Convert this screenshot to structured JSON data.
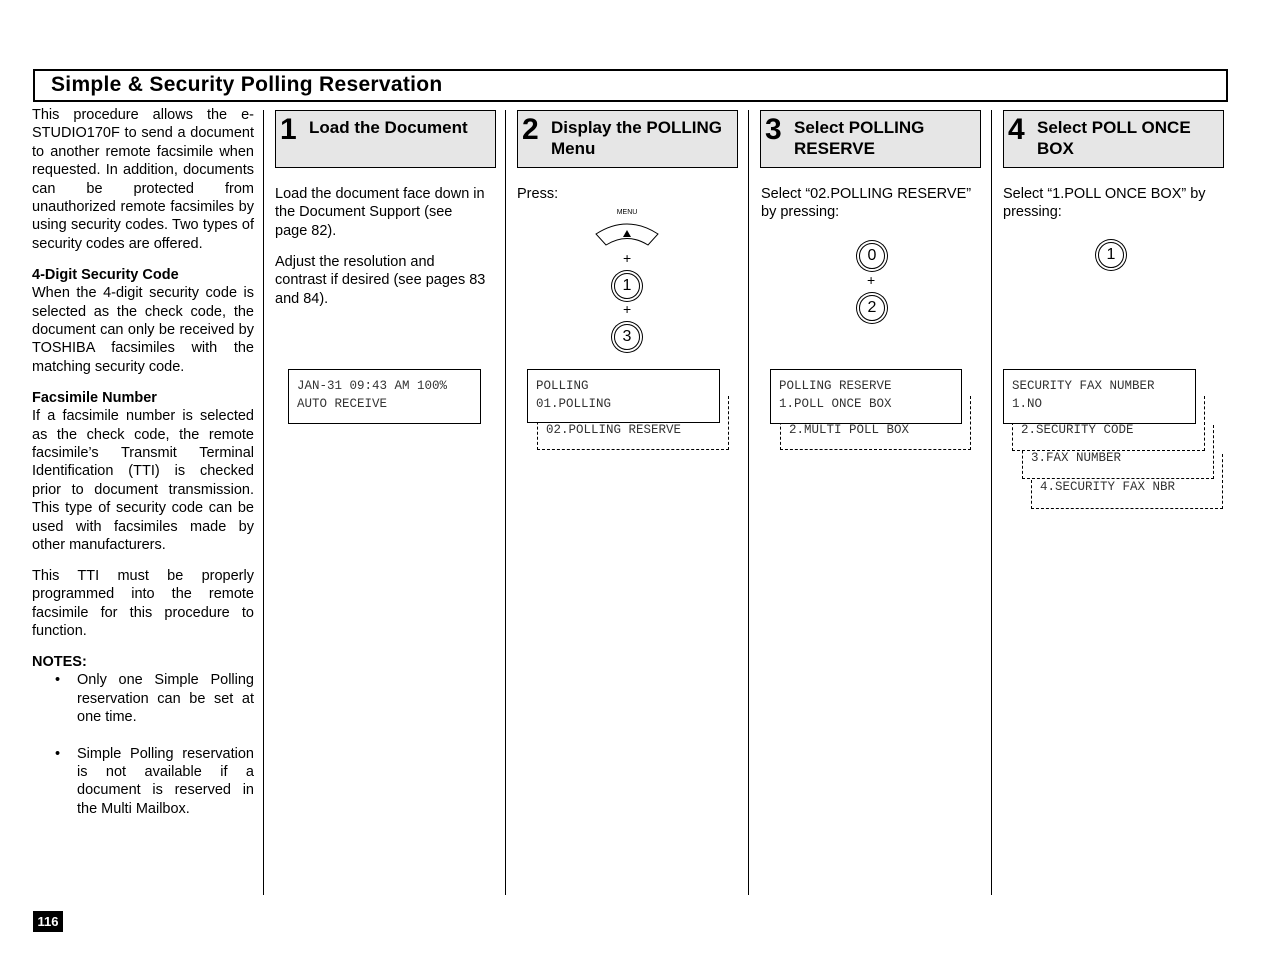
{
  "title": "Simple & Security Polling Reservation",
  "left": {
    "intro": "This procedure allows the e-STUDIO170F to send a document to another remote facsimile when requested. In addition, documents can be protected from unauthorized remote facsimiles by using security codes. Two types of security codes are offered.",
    "code_heading": "4-Digit Security Code",
    "code_text": "When the 4-digit security code is selected as the check code, the document can only be received by TOSHIBA facsimiles with the matching security code.",
    "fax_heading": "Facsimile Number",
    "fax_text": "If a facsimile number is selected as the check code, the remote facsimile’s Transmit Terminal Identification (TTI) is checked prior to document transmission. This type of security code can be used with facsimiles made by other manufacturers.",
    "tti_text": "This TTI must be properly programmed into the remote facsimile for this procedure to function.",
    "notes_heading": "NOTES:",
    "notes": [
      "Only one Simple Polling reservation can be set at one time.",
      "Simple Polling reservation is not available if a document is reserved in the Multi Mailbox."
    ]
  },
  "steps": [
    {
      "num": "1",
      "label": "Load the Document",
      "body": [
        "Load the document face down in the Document Support (see page 82).",
        "Adjust the resolution and contrast if desired (see pages 83 and 84)."
      ],
      "lcd": [
        "JAN-31 09:43 AM 100%",
        "AUTO RECEIVE"
      ]
    },
    {
      "num": "2",
      "label": "Display the POLLING Menu",
      "body": [
        "Press:"
      ],
      "menu_key": "MENU",
      "keys": [
        "1",
        "3"
      ],
      "plus": "+",
      "lcd": [
        "POLLING",
        "01.POLLING"
      ],
      "options": [
        "02.POLLING RESERVE"
      ]
    },
    {
      "num": "3",
      "label": "Select POLLING RESERVE",
      "body": [
        "Select “02.POLLING RESERVE” by pressing:"
      ],
      "keys": [
        "0",
        "2"
      ],
      "plus": "+",
      "lcd": [
        "POLLING RESERVE",
        "1.POLL ONCE BOX"
      ],
      "options": [
        "2.MULTI POLL BOX"
      ]
    },
    {
      "num": "4",
      "label": "Select POLL ONCE BOX",
      "body": [
        "Select “1.POLL ONCE BOX” by pressing:"
      ],
      "keys": [
        "1"
      ],
      "lcd": [
        "SECURITY FAX NUMBER",
        "1.NO"
      ],
      "options": [
        "2.SECURITY CODE",
        "3.FAX NUMBER",
        "4.SECURITY FAX NBR"
      ]
    }
  ],
  "page_number": "116"
}
